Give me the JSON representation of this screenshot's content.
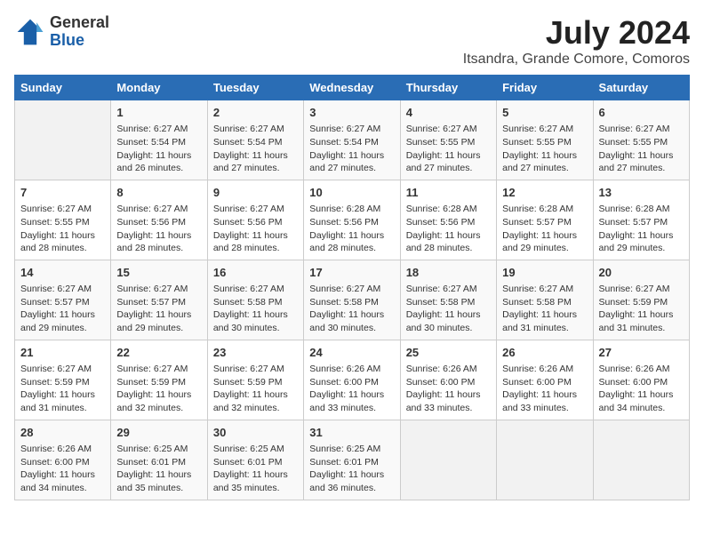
{
  "logo": {
    "general": "General",
    "blue": "Blue"
  },
  "title": "July 2024",
  "subtitle": "Itsandra, Grande Comore, Comoros",
  "headers": [
    "Sunday",
    "Monday",
    "Tuesday",
    "Wednesday",
    "Thursday",
    "Friday",
    "Saturday"
  ],
  "weeks": [
    [
      {
        "day": "",
        "info": ""
      },
      {
        "day": "1",
        "info": "Sunrise: 6:27 AM\nSunset: 5:54 PM\nDaylight: 11 hours\nand 26 minutes."
      },
      {
        "day": "2",
        "info": "Sunrise: 6:27 AM\nSunset: 5:54 PM\nDaylight: 11 hours\nand 27 minutes."
      },
      {
        "day": "3",
        "info": "Sunrise: 6:27 AM\nSunset: 5:54 PM\nDaylight: 11 hours\nand 27 minutes."
      },
      {
        "day": "4",
        "info": "Sunrise: 6:27 AM\nSunset: 5:55 PM\nDaylight: 11 hours\nand 27 minutes."
      },
      {
        "day": "5",
        "info": "Sunrise: 6:27 AM\nSunset: 5:55 PM\nDaylight: 11 hours\nand 27 minutes."
      },
      {
        "day": "6",
        "info": "Sunrise: 6:27 AM\nSunset: 5:55 PM\nDaylight: 11 hours\nand 27 minutes."
      }
    ],
    [
      {
        "day": "7",
        "info": "Sunrise: 6:27 AM\nSunset: 5:55 PM\nDaylight: 11 hours\nand 28 minutes."
      },
      {
        "day": "8",
        "info": "Sunrise: 6:27 AM\nSunset: 5:56 PM\nDaylight: 11 hours\nand 28 minutes."
      },
      {
        "day": "9",
        "info": "Sunrise: 6:27 AM\nSunset: 5:56 PM\nDaylight: 11 hours\nand 28 minutes."
      },
      {
        "day": "10",
        "info": "Sunrise: 6:28 AM\nSunset: 5:56 PM\nDaylight: 11 hours\nand 28 minutes."
      },
      {
        "day": "11",
        "info": "Sunrise: 6:28 AM\nSunset: 5:56 PM\nDaylight: 11 hours\nand 28 minutes."
      },
      {
        "day": "12",
        "info": "Sunrise: 6:28 AM\nSunset: 5:57 PM\nDaylight: 11 hours\nand 29 minutes."
      },
      {
        "day": "13",
        "info": "Sunrise: 6:28 AM\nSunset: 5:57 PM\nDaylight: 11 hours\nand 29 minutes."
      }
    ],
    [
      {
        "day": "14",
        "info": "Sunrise: 6:27 AM\nSunset: 5:57 PM\nDaylight: 11 hours\nand 29 minutes."
      },
      {
        "day": "15",
        "info": "Sunrise: 6:27 AM\nSunset: 5:57 PM\nDaylight: 11 hours\nand 29 minutes."
      },
      {
        "day": "16",
        "info": "Sunrise: 6:27 AM\nSunset: 5:58 PM\nDaylight: 11 hours\nand 30 minutes."
      },
      {
        "day": "17",
        "info": "Sunrise: 6:27 AM\nSunset: 5:58 PM\nDaylight: 11 hours\nand 30 minutes."
      },
      {
        "day": "18",
        "info": "Sunrise: 6:27 AM\nSunset: 5:58 PM\nDaylight: 11 hours\nand 30 minutes."
      },
      {
        "day": "19",
        "info": "Sunrise: 6:27 AM\nSunset: 5:58 PM\nDaylight: 11 hours\nand 31 minutes."
      },
      {
        "day": "20",
        "info": "Sunrise: 6:27 AM\nSunset: 5:59 PM\nDaylight: 11 hours\nand 31 minutes."
      }
    ],
    [
      {
        "day": "21",
        "info": "Sunrise: 6:27 AM\nSunset: 5:59 PM\nDaylight: 11 hours\nand 31 minutes."
      },
      {
        "day": "22",
        "info": "Sunrise: 6:27 AM\nSunset: 5:59 PM\nDaylight: 11 hours\nand 32 minutes."
      },
      {
        "day": "23",
        "info": "Sunrise: 6:27 AM\nSunset: 5:59 PM\nDaylight: 11 hours\nand 32 minutes."
      },
      {
        "day": "24",
        "info": "Sunrise: 6:26 AM\nSunset: 6:00 PM\nDaylight: 11 hours\nand 33 minutes."
      },
      {
        "day": "25",
        "info": "Sunrise: 6:26 AM\nSunset: 6:00 PM\nDaylight: 11 hours\nand 33 minutes."
      },
      {
        "day": "26",
        "info": "Sunrise: 6:26 AM\nSunset: 6:00 PM\nDaylight: 11 hours\nand 33 minutes."
      },
      {
        "day": "27",
        "info": "Sunrise: 6:26 AM\nSunset: 6:00 PM\nDaylight: 11 hours\nand 34 minutes."
      }
    ],
    [
      {
        "day": "28",
        "info": "Sunrise: 6:26 AM\nSunset: 6:00 PM\nDaylight: 11 hours\nand 34 minutes."
      },
      {
        "day": "29",
        "info": "Sunrise: 6:25 AM\nSunset: 6:01 PM\nDaylight: 11 hours\nand 35 minutes."
      },
      {
        "day": "30",
        "info": "Sunrise: 6:25 AM\nSunset: 6:01 PM\nDaylight: 11 hours\nand 35 minutes."
      },
      {
        "day": "31",
        "info": "Sunrise: 6:25 AM\nSunset: 6:01 PM\nDaylight: 11 hours\nand 36 minutes."
      },
      {
        "day": "",
        "info": ""
      },
      {
        "day": "",
        "info": ""
      },
      {
        "day": "",
        "info": ""
      }
    ]
  ]
}
